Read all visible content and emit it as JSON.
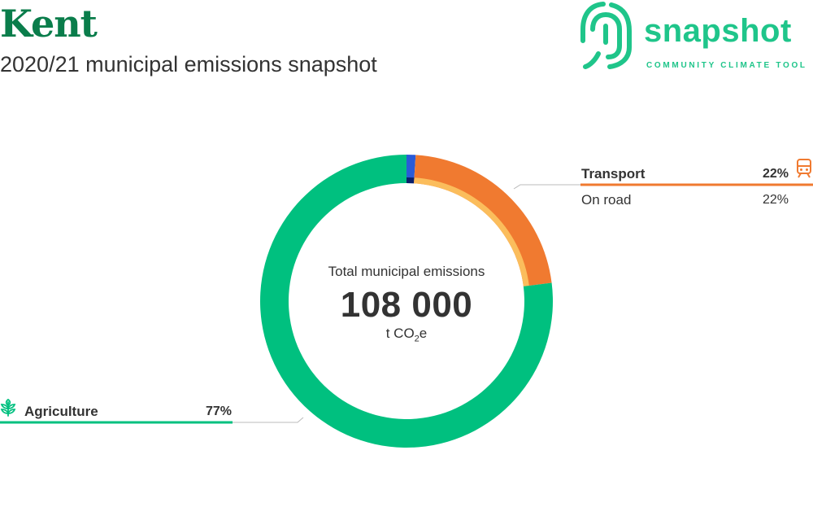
{
  "header": {
    "place": "Kent",
    "subtitle": "2020/21 municipal emissions snapshot"
  },
  "logo": {
    "word": "snapshot",
    "tagline": "COMMUNITY CLIMATE TOOL",
    "icon": "fingerprint-logo-icon",
    "color": "#1fc58a"
  },
  "center": {
    "label": "Total municipal emissions",
    "value": "108 000",
    "unit_prefix": "t CO",
    "unit_sub": "2",
    "unit_suffix": "e"
  },
  "chart_data": {
    "type": "pie",
    "donut": true,
    "total": 108000,
    "unit": "t CO2e",
    "slices": [
      {
        "name": "",
        "percent": 1,
        "color": "#2a5bd7",
        "inner_color": "#0a1f6b"
      },
      {
        "name": "Transport",
        "percent": 22,
        "color": "#f07a30",
        "inner_color": "#fbbd5c",
        "icon": "train-icon",
        "subsectors": [
          {
            "name": "On road",
            "percent": 22
          }
        ]
      },
      {
        "name": "Agriculture",
        "percent": 77,
        "color": "#00c07f",
        "icon": "wheat-icon"
      }
    ]
  },
  "labels": {
    "transport_name": "Transport",
    "transport_pct": "22%",
    "transport_sub_name": "On road",
    "transport_sub_pct": "22%",
    "agriculture_name": "Agriculture",
    "agriculture_pct": "77%"
  }
}
